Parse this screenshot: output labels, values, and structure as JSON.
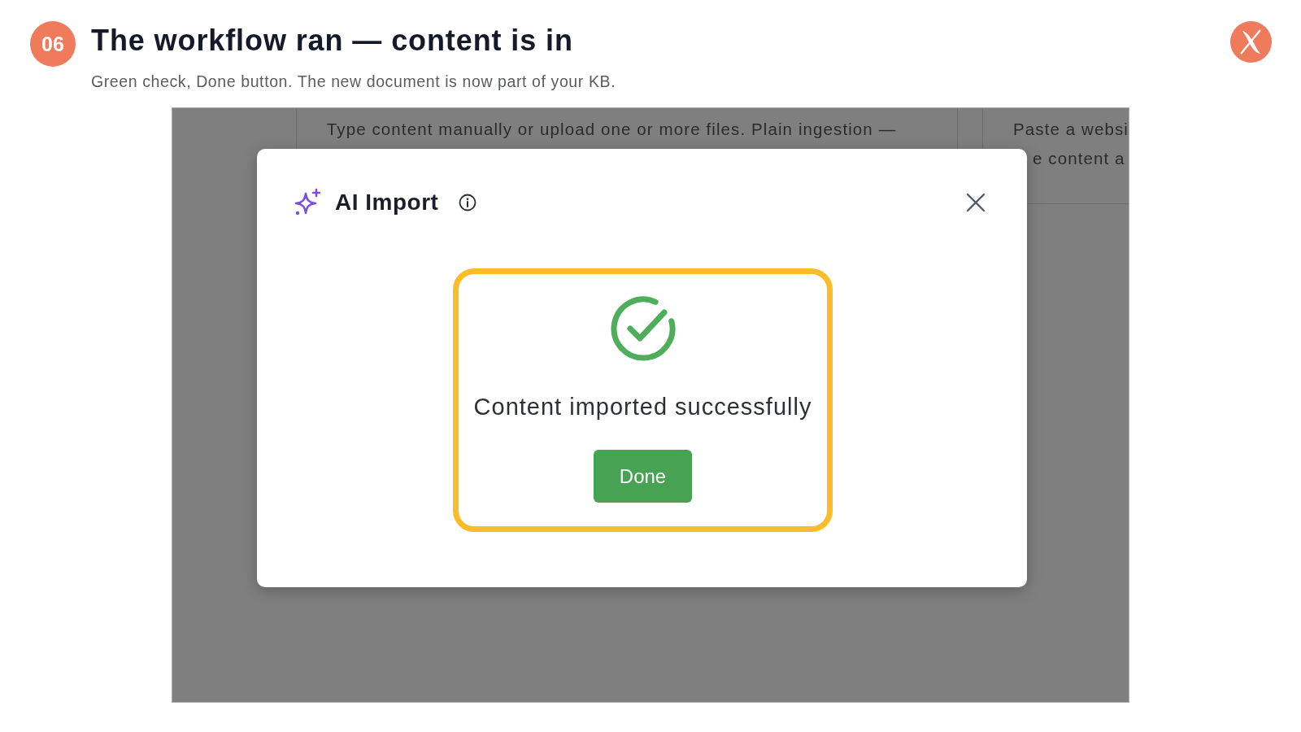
{
  "slide": {
    "step": "06",
    "title": "The workflow ran — content is in",
    "subtitle": "Green check, Done button. The new document is now part of your KB."
  },
  "background_page": {
    "description_text": "Type content manually or upload one or more files. Plain ingestion —",
    "side_text_lines": [
      "Paste a websi",
      "e content a"
    ]
  },
  "dialog": {
    "title": "AI Import",
    "message": "Content imported successfully",
    "done_button": "Done",
    "highlighted": true
  }
}
